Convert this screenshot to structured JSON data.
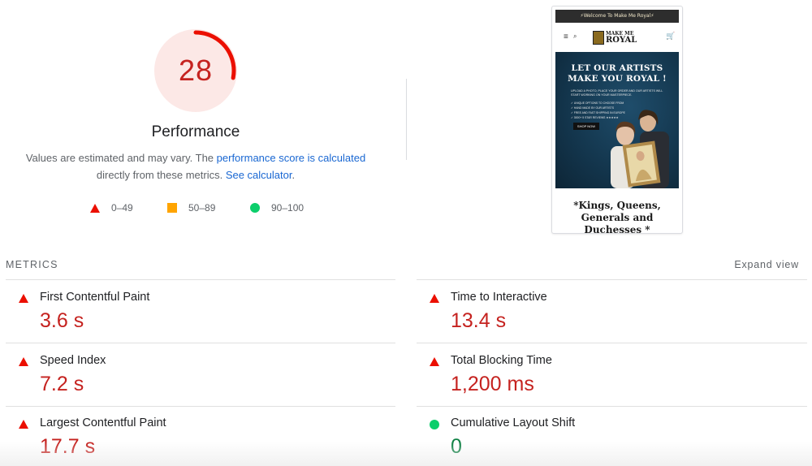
{
  "gauge": {
    "score": "28",
    "score_fraction": 0.28,
    "color": "#eb0f00",
    "bg_color": "#fce8e6"
  },
  "performance": {
    "title": "Performance",
    "desc_line1_prefix": "Values are estimated and may vary. The ",
    "desc_link1": "performance score is calculated",
    "desc_line2_prefix": "directly from these metrics. ",
    "desc_link2": "See calculator",
    "desc_line2_suffix": "."
  },
  "legend": [
    {
      "label": "0–49",
      "shape": "triangle",
      "color": "#eb0f00"
    },
    {
      "label": "50–89",
      "shape": "square",
      "color": "#ffa400"
    },
    {
      "label": "90–100",
      "shape": "circle",
      "color": "#0cce6b"
    }
  ],
  "screenshot": {
    "banner": "⚡Welcome To Make Me Royal⚡",
    "logo_top": "MAKE ME",
    "logo_bottom": "ROYAL",
    "hero_title": "LET OUR ARTISTS MAKE YOU ROYAL !",
    "hero_sub": "UPLOAD A PHOTO, PLACE YOUR ORDER AND OUR ARTISTS WILL START WORKING ON YOUR MASTERPIECE.",
    "hero_list": [
      "✓ UNIQUE OPTIONS TO CHOOSE FROM",
      "✓ HAND MADE BY OUR ARTISTS",
      "✓ FREE AND FAST SHIPPING IN EUROPE",
      "✓ 3000+ 5 STAR REVIEWS ★★★★★"
    ],
    "hero_button": "SHOP NOW",
    "heading": "*Kings, Queens, Generals and Duchesses *"
  },
  "metrics": {
    "label": "METRICS",
    "expand": "Expand view",
    "items": [
      {
        "name": "First Contentful Paint",
        "value": "3.6 s",
        "status": "poor"
      },
      {
        "name": "Time to Interactive",
        "value": "13.4 s",
        "status": "poor"
      },
      {
        "name": "Speed Index",
        "value": "7.2 s",
        "status": "poor"
      },
      {
        "name": "Total Blocking Time",
        "value": "1,200 ms",
        "status": "poor"
      },
      {
        "name": "Largest Contentful Paint",
        "value": "17.7 s",
        "status": "poor"
      },
      {
        "name": "Cumulative Layout Shift",
        "value": "0",
        "status": "good"
      }
    ]
  }
}
